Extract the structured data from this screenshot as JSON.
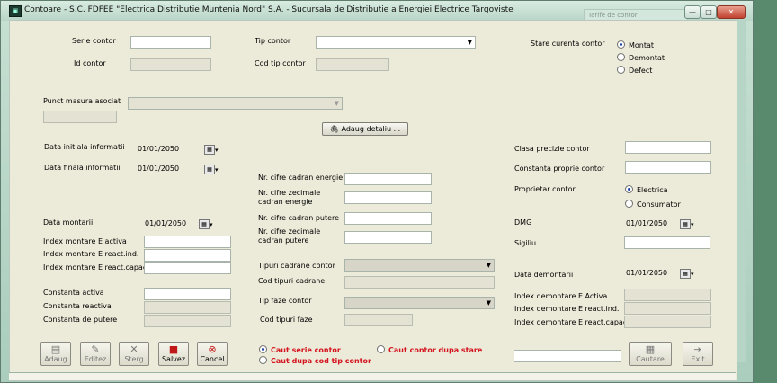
{
  "window": {
    "title": "Contoare - S.C. FDFEE \"Electrica Distributie Muntenia Nord\" S.A. - Sucursala de Distributie a Energiei Electrice Targoviste",
    "ghost_field": "Tarife de contor",
    "controls": [
      "—",
      "□",
      "✕"
    ]
  },
  "form": {
    "serie_contor": {
      "label": "Serie contor",
      "value": ""
    },
    "id_contor": {
      "label": "Id contor",
      "value": ""
    },
    "tip_contor": {
      "label": "Tip contor",
      "value": ""
    },
    "cod_tip_contor": {
      "label": "Cod tip contor",
      "value": ""
    },
    "stare_curenta": {
      "label": "Stare curenta contor",
      "options": [
        "Montat",
        "Demontat",
        "Defect"
      ],
      "selected": "Montat"
    },
    "punct_masura": {
      "label": "Punct masura asociat",
      "value": ""
    },
    "adaug_detaliu": "Adaug detaliu ...",
    "data_initiala": {
      "label": "Data initiala informatii",
      "value": "01/01/2050"
    },
    "data_finala": {
      "label": "Data finala informatii",
      "value": "01/01/2050"
    },
    "nr_cifre_cadran_energie": {
      "label": "Nr. cifre cadran energie",
      "value": ""
    },
    "nr_cifre_zecimale_energie": {
      "label_line1": "Nr. cifre zecimale",
      "label_line2": "cadran energie",
      "value": ""
    },
    "nr_cifre_cadran_putere": {
      "label": "Nr. cifre cadran putere",
      "value": ""
    },
    "nr_cifre_zecimale_putere": {
      "label_line1": "Nr. cifre zecimale",
      "label_line2": "cadran putere",
      "value": ""
    },
    "data_montarii": {
      "label": "Data montarii",
      "value": "01/01/2050"
    },
    "index_montare_activa": {
      "label": "Index montare E activa",
      "value": ""
    },
    "index_montare_react_ind": {
      "label": "Index montare E react.ind.",
      "value": ""
    },
    "index_montare_react_capacit": {
      "label": "Index montare E react.capacit",
      "value": ""
    },
    "constanta_activa": {
      "label": "Constanta activa",
      "value": ""
    },
    "constanta_reactiva": {
      "label": "Constanta reactiva",
      "value": ""
    },
    "constanta_putere": {
      "label": "Constanta de putere",
      "value": ""
    },
    "tipuri_cadrane": {
      "label": "Tipuri cadrane contor",
      "value": ""
    },
    "cod_tipuri_cadrane": {
      "label": "Cod tipuri cadrane",
      "value": ""
    },
    "tip_faze": {
      "label": "Tip faze contor",
      "value": ""
    },
    "cod_tipuri_faze": {
      "label": "Cod tipuri faze",
      "value": ""
    },
    "clasa_precizie": {
      "label": "Clasa precizie contor",
      "value": ""
    },
    "constanta_proprie": {
      "label": "Constanta proprie contor",
      "value": ""
    },
    "proprietar": {
      "label": "Proprietar contor",
      "options": [
        "Electrica",
        "Consumator"
      ],
      "selected": "Electrica"
    },
    "dmg": {
      "label": "DMG",
      "value": "01/01/2050"
    },
    "sigiliu": {
      "label": "Sigiliu",
      "value": ""
    },
    "data_demontarii": {
      "label": "Data demontarii",
      "value": "01/01/2050"
    },
    "index_demontare_activa": {
      "label": "Index demontare E Activa",
      "value": ""
    },
    "index_demontare_react_ind": {
      "label": "Index demontare E react.ind.",
      "value": ""
    },
    "index_demontare_react_capacit": {
      "label": "Index demontare E react.capacit",
      "value": ""
    }
  },
  "toolbar": {
    "adaug": "Adaug",
    "editez": "Editez",
    "sterg": "Sterg",
    "salvez": "Salvez",
    "cancel": "Cancel",
    "cautare": "Cautare",
    "exit": "Exit"
  },
  "search": {
    "options": [
      "Caut serie contor",
      "Caut dupa cod tip contor",
      "Caut contor dupa stare"
    ],
    "selected": "Caut serie contor",
    "value": ""
  },
  "colors": {
    "accent_red": "#d4141e",
    "client_bg": "#ecead9",
    "window_bg": "#bcdccb"
  }
}
